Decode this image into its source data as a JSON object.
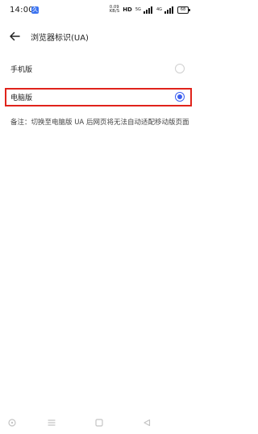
{
  "status_bar": {
    "time": "14:00",
    "app_badge": "久",
    "speed_top": "0.09",
    "speed_bottom": "KB/S",
    "hd_label": "HD",
    "signal1_label": "5G",
    "signal2_label": "4G",
    "battery": "68"
  },
  "header": {
    "title": "浏览器标识(UA)"
  },
  "options": [
    {
      "label": "手机版",
      "selected": false
    },
    {
      "label": "电脑版",
      "selected": true
    }
  ],
  "note": "备注：切换至电脑版 UA 后网页将无法自动适配移动版页面",
  "colors": {
    "accent": "#3b5ff0",
    "highlight": "#e0231b"
  },
  "nav_icons": [
    "circle-icon",
    "menu-icon",
    "square-icon",
    "back-triangle-icon"
  ]
}
